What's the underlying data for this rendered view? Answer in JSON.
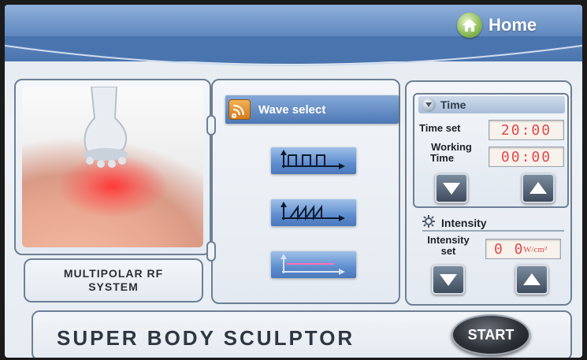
{
  "header": {
    "home_label": "Home"
  },
  "left": {
    "system_label": "MULTIPOLAR RF SYSTEM"
  },
  "wave": {
    "select_label": "Wave select",
    "options": [
      {
        "icon": "square-wave-icon"
      },
      {
        "icon": "sawtooth-wave-icon"
      },
      {
        "icon": "flat-line-wave-icon"
      }
    ]
  },
  "time": {
    "title": "Time",
    "time_set_label": "Time set",
    "time_set_value": "20:00",
    "working_label_1": "Working",
    "working_label_2": "Time",
    "working_value": "00:00"
  },
  "intensity": {
    "title": "Intensity",
    "set_label_1": "Intensity",
    "set_label_2": "set",
    "value": "0 0",
    "unit": "W/cm²"
  },
  "footer": {
    "brand": "SUPER BODY SCULPTOR",
    "start_label": "START"
  },
  "colors": {
    "header": "#5f88bf",
    "wave_button": "#5e8dcf",
    "lcd_text": "#e14a4a",
    "start_button": "#2e3238"
  }
}
